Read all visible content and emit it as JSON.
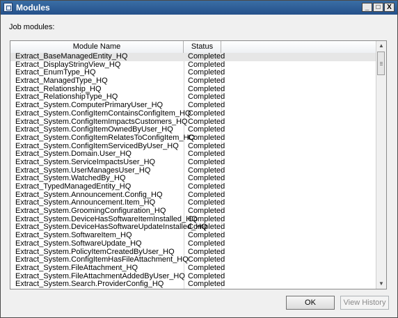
{
  "window": {
    "title": "Modules",
    "app_icon": "window-app-icon"
  },
  "controls": {
    "minimize": "_",
    "maximize": "□",
    "close": "X"
  },
  "label": "Job modules:",
  "table": {
    "columns": [
      "Module Name",
      "Status"
    ],
    "rows": [
      {
        "name": "Extract_BaseManagedEntity_HQ",
        "status": "Completed"
      },
      {
        "name": "Extract_DisplayStringView_HQ",
        "status": "Completed"
      },
      {
        "name": "Extract_EnumType_HQ",
        "status": "Completed"
      },
      {
        "name": "Extract_ManagedType_HQ",
        "status": "Completed"
      },
      {
        "name": "Extract_Relationship_HQ",
        "status": "Completed"
      },
      {
        "name": "Extract_RelationshipType_HQ",
        "status": "Completed"
      },
      {
        "name": "Extract_System.ComputerPrimaryUser_HQ",
        "status": "Completed"
      },
      {
        "name": "Extract_System.ConfigItemContainsConfigItem_HQ",
        "status": "Completed"
      },
      {
        "name": "Extract_System.ConfigItemImpactsCustomers_HQ",
        "status": "Completed"
      },
      {
        "name": "Extract_System.ConfigItemOwnedByUser_HQ",
        "status": "Completed"
      },
      {
        "name": "Extract_System.ConfigItemRelatesToConfigItem_HQ",
        "status": "Completed"
      },
      {
        "name": "Extract_System.ConfigItemServicedByUser_HQ",
        "status": "Completed"
      },
      {
        "name": "Extract_System.Domain.User_HQ",
        "status": "Completed"
      },
      {
        "name": "Extract_System.ServiceImpactsUser_HQ",
        "status": "Completed"
      },
      {
        "name": "Extract_System.UserManagesUser_HQ",
        "status": "Completed"
      },
      {
        "name": "Extract_System.WatchedBy_HQ",
        "status": "Completed"
      },
      {
        "name": "Extract_TypedManagedEntity_HQ",
        "status": "Completed"
      },
      {
        "name": "Extract_System.Announcement.Config_HQ",
        "status": "Completed"
      },
      {
        "name": "Extract_System.Announcement.Item_HQ",
        "status": "Completed"
      },
      {
        "name": "Extract_System.GroomingConfiguration_HQ",
        "status": "Completed"
      },
      {
        "name": "Extract_System.DeviceHasSoftwareItemInstalled_HQ",
        "status": "Completed"
      },
      {
        "name": "Extract_System.DeviceHasSoftwareUpdateInstalled_HQ",
        "status": "Completed"
      },
      {
        "name": "Extract_System.SoftwareItem_HQ",
        "status": "Completed"
      },
      {
        "name": "Extract_System.SoftwareUpdate_HQ",
        "status": "Completed"
      },
      {
        "name": "Extract_System.PolicyItemCreatedByUser_HQ",
        "status": "Completed"
      },
      {
        "name": "Extract_System.ConfigItemHasFileAttachment_HQ",
        "status": "Completed"
      },
      {
        "name": "Extract_System.FileAttachment_HQ",
        "status": "Completed"
      },
      {
        "name": "Extract_System.FileAttachmentAddedByUser_HQ",
        "status": "Completed"
      },
      {
        "name": "Extract_System.Search.ProviderConfig_HQ",
        "status": "Completed"
      }
    ]
  },
  "buttons": {
    "ok": "OK",
    "view_history": "View History"
  }
}
